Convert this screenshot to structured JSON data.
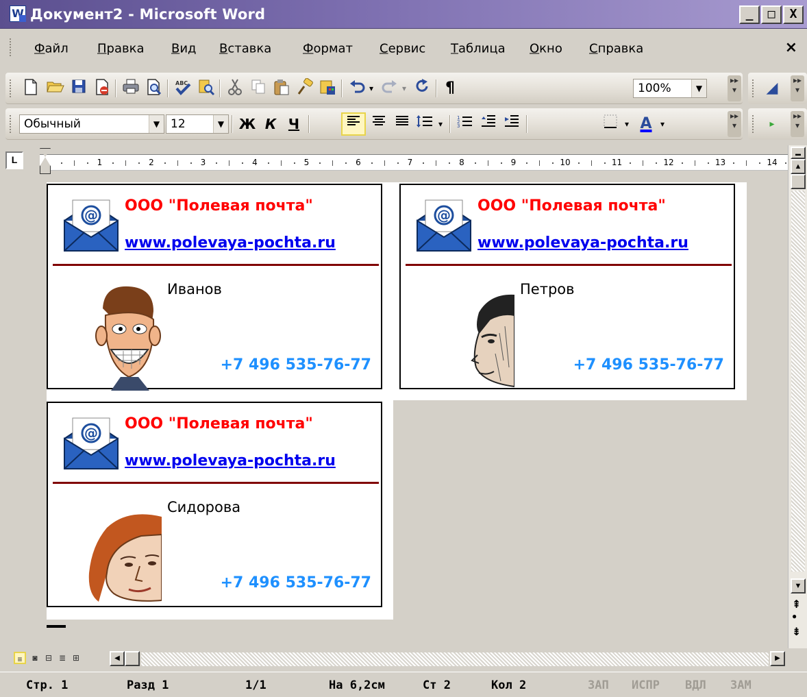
{
  "window": {
    "title": "Документ2 - Microsoft Word",
    "app_icon": "W",
    "minimize_label": "_",
    "maximize_label": "□",
    "close_label": "X",
    "doc_close_label": "×"
  },
  "menu": {
    "items": [
      "Файл",
      "Правка",
      "Вид",
      "Вставка",
      "Формат",
      "Сервис",
      "Таблица",
      "Окно",
      "Справка"
    ]
  },
  "toolbar_standard": {
    "icons": [
      "new-document-icon",
      "open-folder-icon",
      "save-icon",
      "permission-icon",
      "print-icon",
      "print-preview-icon",
      "spelling-icon",
      "research-icon",
      "cut-icon",
      "copy-icon",
      "paste-icon",
      "format-painter-icon",
      "insert-hyperlink-icon",
      "undo-icon",
      "redo-icon",
      "refresh-icon",
      "show-formatting-icon"
    ],
    "zoom": "100%",
    "paragraph_mark": "¶"
  },
  "toolbar_formatting": {
    "style": "Обычный",
    "font_size": "12",
    "bold": "Ж",
    "italic": "К",
    "underline": "Ч",
    "font_color": "A"
  },
  "ruler": {
    "tab_stop": "L",
    "numbers": [
      "1",
      "2",
      "3",
      "4",
      "5",
      "6",
      "7",
      "8",
      "9",
      "10",
      "11",
      "12",
      "13",
      "14"
    ]
  },
  "cards": [
    {
      "company": "ООО \"Полевая почта\"",
      "website": "www.polevaya-pochta.ru",
      "name": "Иванов",
      "phone": "+7 496 535-76-77"
    },
    {
      "company": "ООО \"Полевая почта\"",
      "website": "www.polevaya-pochta.ru",
      "name": "Петров",
      "phone": "+7 496 535-76-77"
    },
    {
      "company": "ООО \"Полевая почта\"",
      "website": "www.polevaya-pochta.ru",
      "name": "Сидорова",
      "phone": "+7 496 535-76-77"
    }
  ],
  "statusbar": {
    "page": "Стр. 1",
    "section": "Разд 1",
    "pages": "1/1",
    "position": "На 6,2см",
    "line": "Ст 2",
    "column": "Кол 2",
    "rec": "ЗАП",
    "trk": "ИСПР",
    "ext": "ВДЛ",
    "ovr": "ЗАМ"
  },
  "colors": {
    "company_text": "#ff0000",
    "website_link": "#0000ee",
    "phone_text": "#1e90ff",
    "divider": "#800000"
  }
}
